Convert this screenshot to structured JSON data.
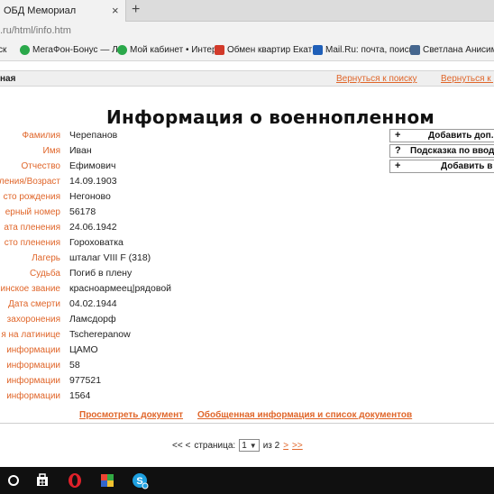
{
  "browser": {
    "tab_title": "ОБД Мемориал",
    "tab_close": "×",
    "new_tab": "+",
    "url_dim": ".ru",
    "url_path": "/html/info.htm",
    "bookmarks": [
      {
        "label": "ск",
        "icon_color": "#cccccc"
      },
      {
        "label": "МегаФон-Бонус — Л",
        "icon_color": "#2aa84a"
      },
      {
        "label": "Мой кабинет • Интер",
        "icon_color": "#2aa84a"
      },
      {
        "label": "Обмен квартир Екат",
        "icon_color": "#d23a2a"
      },
      {
        "label": "Mail.Ru: почта, поиск",
        "icon_color": "#1f5fb8"
      },
      {
        "label": "Светлана Анисимов",
        "icon_color": "#45668e"
      }
    ]
  },
  "site": {
    "strip_left": "ная",
    "back_search": "Вернуться к поиску",
    "back_other": "Вернуться к р"
  },
  "page_title": "Информация о военнопленном",
  "fields": [
    {
      "label": "Фамилия",
      "value": "Черепанов"
    },
    {
      "label": "Имя",
      "value": "Иван"
    },
    {
      "label": "Отчество",
      "value": "Ефимович"
    },
    {
      "label": "ления/Возраст",
      "value": "14.09.1903"
    },
    {
      "label": "сто рождения",
      "value": "Негоново"
    },
    {
      "label": "ерный номер",
      "value": "56178"
    },
    {
      "label": "ата пленения",
      "value": "24.06.1942"
    },
    {
      "label": "сто пленения",
      "value": "Гороховатка"
    },
    {
      "label": "Лагерь",
      "value": "шталаг VIII F (318)"
    },
    {
      "label": "Судьба",
      "value": "Погиб в плену"
    },
    {
      "label": "инское звание",
      "value": "красноармеец|рядовой"
    },
    {
      "label": "Дата смерти",
      "value": "04.02.1944"
    },
    {
      "label": "захоронения",
      "value": "Ламсдорф"
    },
    {
      "label": "я на латинице",
      "value": "Tscherepanow"
    },
    {
      "label": "информации",
      "value": "ЦАМО"
    },
    {
      "label": "информации",
      "value": "58"
    },
    {
      "label": "информации",
      "value": "977521"
    },
    {
      "label": "информации",
      "value": "1564"
    }
  ],
  "side_actions": [
    {
      "symbol": "+",
      "label": "Добавить доп.и"
    },
    {
      "symbol": "?",
      "label": "Подсказка по вводу"
    },
    {
      "symbol": "+",
      "label": "Добавить в к"
    }
  ],
  "bottom_links": {
    "view_doc": "Просмотреть документ",
    "summary": "Обобщенная информация и список документов"
  },
  "pager": {
    "prev": "<< <",
    "page_word": "страница:",
    "current": "1",
    "of_word": "из 2",
    "next": ">",
    "last": ">>"
  },
  "taskbar": [
    {
      "name": "cortana-icon",
      "color": "#ffffff"
    },
    {
      "name": "store-icon",
      "color": "#ffffff"
    },
    {
      "name": "opera-icon",
      "color": "#e0212a"
    },
    {
      "name": "paint-icon",
      "color": "#f2c230"
    },
    {
      "name": "skype-icon",
      "color": "#1ea0e0"
    }
  ]
}
